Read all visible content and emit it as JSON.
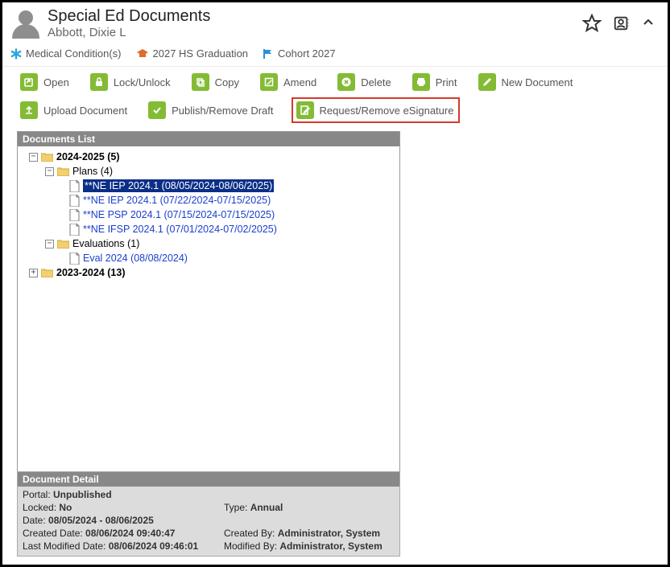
{
  "header": {
    "title": "Special Ed Documents",
    "student": "Abbott, Dixie L"
  },
  "tags": [
    {
      "icon": "asterisk",
      "color": "#2aa4de",
      "label": "Medical Condition(s)"
    },
    {
      "icon": "grad",
      "color": "#e06a2b",
      "label": "2027 HS Graduation"
    },
    {
      "icon": "flag",
      "color": "#2a91d6",
      "label": "Cohort 2027"
    }
  ],
  "actions_row1": {
    "open": "Open",
    "lock": "Lock/Unlock",
    "copy": "Copy",
    "amend": "Amend",
    "delete": "Delete",
    "print": "Print",
    "newdoc": "New Document"
  },
  "actions_row2": {
    "upload": "Upload Document",
    "publish": "Publish/Remove Draft",
    "esig": "Request/Remove eSignature"
  },
  "docs_panel_title": "Documents List",
  "tree": {
    "y2024": {
      "label": "2024-2025 (5)"
    },
    "plans": {
      "label": "Plans (4)"
    },
    "doc1": "**NE IEP 2024.1 (08/05/2024-08/06/2025)",
    "doc2": "**NE IEP 2024.1 (07/22/2024-07/15/2025)",
    "doc3": "**NE PSP 2024.1 (07/15/2024-07/15/2025)",
    "doc4": "**NE IFSP 2024.1 (07/01/2024-07/02/2025)",
    "evals": {
      "label": "Evaluations (1)"
    },
    "eval1": "Eval 2024 (08/08/2024)",
    "y2023": {
      "label": "2023-2024 (13)"
    }
  },
  "detail": {
    "title": "Document Detail",
    "portal_label": "Portal: ",
    "portal_value": "Unpublished",
    "locked_label": "Locked: ",
    "locked_value": "No",
    "type_label": "Type: ",
    "type_value": "Annual",
    "date_label": "Date: ",
    "date_value": "08/05/2024 - 08/06/2025",
    "created_date_label": "Created Date: ",
    "created_date_value": "08/06/2024 09:40:47",
    "created_by_label": "Created By: ",
    "created_by_value": "Administrator, System",
    "modified_date_label": "Last Modified Date: ",
    "modified_date_value": "08/06/2024 09:46:01",
    "modified_by_label": "Modified By: ",
    "modified_by_value": "Administrator, System"
  }
}
